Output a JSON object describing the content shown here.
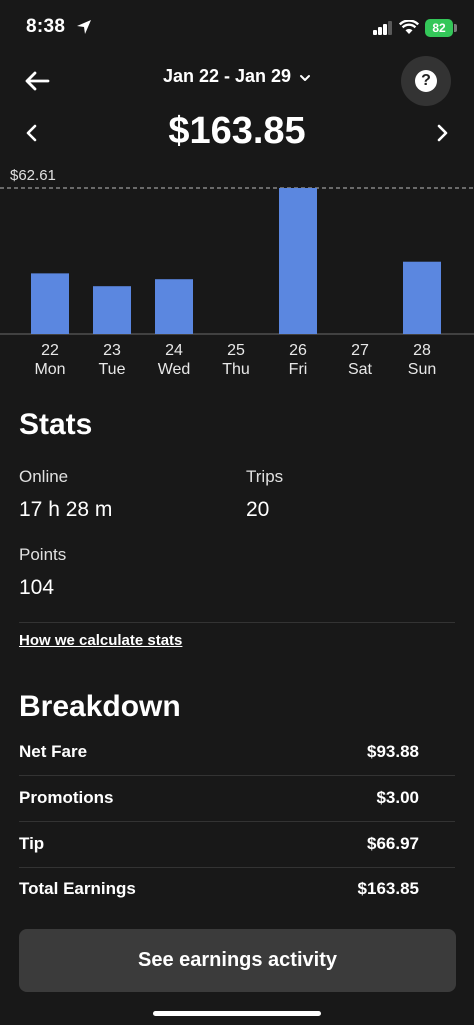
{
  "status_bar": {
    "time": "8:38",
    "battery": "82"
  },
  "header": {
    "date_range": "Jan 22 - Jan 29",
    "total": "$163.85"
  },
  "chart_data": {
    "type": "bar",
    "categories": [
      "22 Mon",
      "23 Tue",
      "24 Wed",
      "25 Thu",
      "26 Fri",
      "27 Sat",
      "28 Sun"
    ],
    "days": [
      "22",
      "23",
      "24",
      "25",
      "26",
      "27",
      "28"
    ],
    "weekdays": [
      "Mon",
      "Tue",
      "Wed",
      "Thu",
      "Fri",
      "Sat",
      "Sun"
    ],
    "values": [
      26.0,
      20.5,
      23.5,
      0,
      62.61,
      0,
      31.0
    ],
    "max_label": "$62.61",
    "max_value": 62.61,
    "bar_color": "#5b87e0"
  },
  "stats": {
    "title": "Stats",
    "online_label": "Online",
    "online_value": "17 h 28 m",
    "trips_label": "Trips",
    "trips_value": "20",
    "points_label": "Points",
    "points_value": "104",
    "calc_link": "How we calculate stats"
  },
  "breakdown": {
    "title": "Breakdown",
    "rows": [
      {
        "label": "Net Fare",
        "value": "$93.88"
      },
      {
        "label": "Promotions",
        "value": "$3.00"
      },
      {
        "label": "Tip",
        "value": "$66.97"
      },
      {
        "label": "Total Earnings",
        "value": "$163.85"
      }
    ]
  },
  "footer": {
    "button_label": "See earnings activity"
  }
}
